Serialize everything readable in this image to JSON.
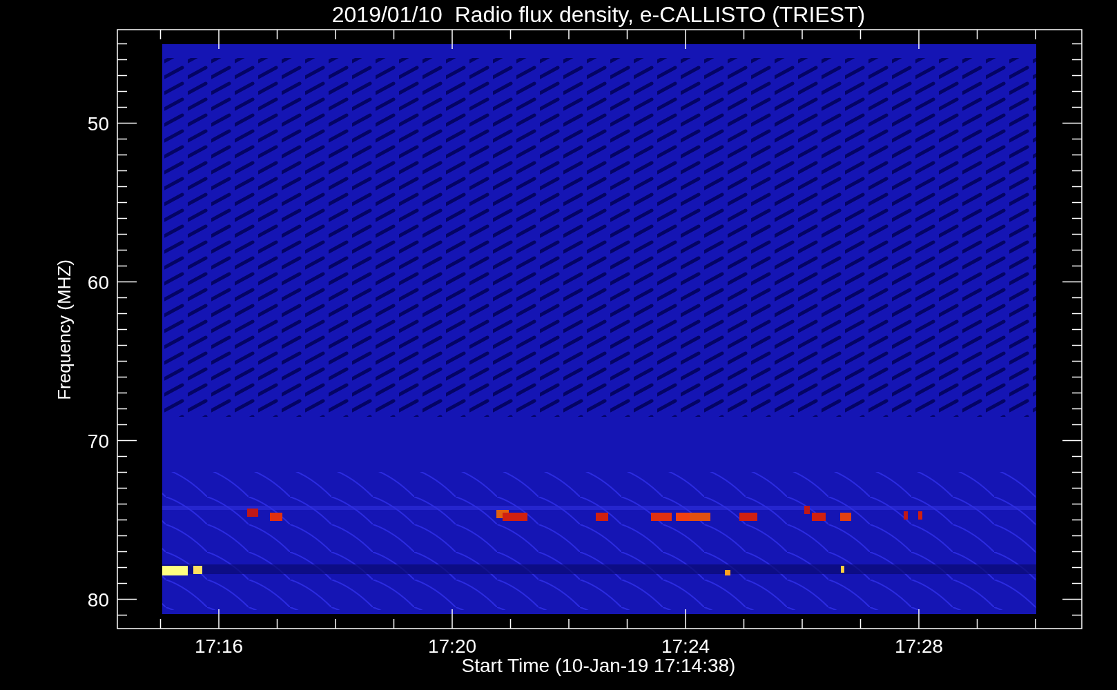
{
  "title": "2019/01/10  Radio flux density, e-CALLISTO (TRIEST)",
  "y_axis": {
    "label": "Frequency (MHZ)",
    "ticks": [
      "50",
      "60",
      "70",
      "80"
    ]
  },
  "x_axis": {
    "label": "Start Time (10-Jan-19 17:14:38)",
    "ticks": [
      "17:16",
      "17:20",
      "17:24",
      "17:28"
    ]
  }
}
